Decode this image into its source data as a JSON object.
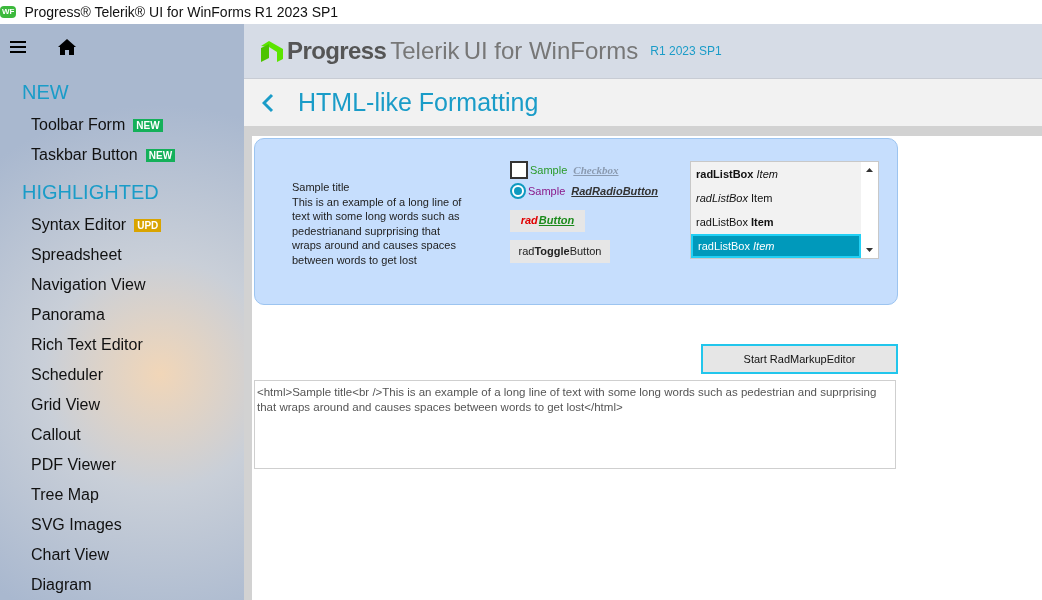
{
  "window": {
    "title": "Progress® Telerik® UI for WinForms R1 2023 SP1",
    "app_badge": "WF"
  },
  "sidebar": {
    "sections": [
      {
        "heading": "NEW",
        "items": [
          {
            "label": "Toolbar Form",
            "badge": "NEW",
            "kind": "new"
          },
          {
            "label": "Taskbar Button",
            "badge": "NEW",
            "kind": "new"
          }
        ]
      },
      {
        "heading": "HIGHLIGHTED",
        "items": [
          {
            "label": "Syntax Editor",
            "badge": "UPD",
            "kind": "upd"
          },
          {
            "label": "Spreadsheet"
          },
          {
            "label": "Navigation View"
          },
          {
            "label": "Panorama"
          },
          {
            "label": "Rich Text Editor"
          },
          {
            "label": "Scheduler"
          },
          {
            "label": "Grid View"
          },
          {
            "label": "Callout"
          },
          {
            "label": "PDF Viewer"
          },
          {
            "label": "Tree Map"
          },
          {
            "label": "SVG Images"
          },
          {
            "label": "Chart View"
          },
          {
            "label": "Diagram"
          }
        ]
      }
    ]
  },
  "header": {
    "brand": "Progress",
    "product": "Telerik",
    "product_rest": "UI for WinForms",
    "version": "R1 2023 SP1"
  },
  "page": {
    "title": "HTML-like Formatting"
  },
  "demo": {
    "label_title": "Sample title",
    "label_body": "This is an example of a long line of text with some long words such as pedestrianand suprprising that wraps around and causes spaces between words to get lost",
    "checkbox": {
      "sample": "Sample",
      "link": "Checkbox",
      "checked": false
    },
    "radio": {
      "sample": "Sample",
      "link": "RadRadioButton",
      "selected": true
    },
    "button": {
      "prefix": "rad",
      "main": "Button"
    },
    "toggle": {
      "text": "rad**Toggle**Button",
      "on": false
    },
    "listbox": [
      {
        "text": "**radListBox** *Item*",
        "selected": false
      },
      {
        "text": "*radListBox* Item",
        "selected": false
      },
      {
        "text": "radListBox **Item**",
        "selected": false
      },
      {
        "text": "radListBox *Item*",
        "selected": true
      }
    ]
  },
  "start_button": "Start RadMarkupEditor",
  "markup": "<html>Sample title<br />This is an example of a long line of text with some long words such as pedestrian and suprprising that wraps around and causes spaces between words to get lost</html>"
}
